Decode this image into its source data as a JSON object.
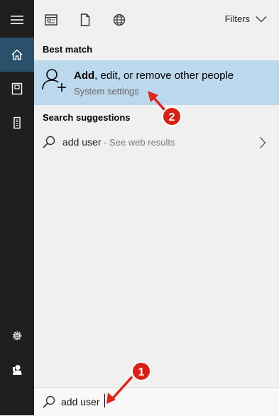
{
  "sidebar": {
    "items": [
      {
        "icon": "hamburger-menu-icon",
        "active": false
      },
      {
        "icon": "home-icon",
        "active": true
      },
      {
        "icon": "notebook-icon",
        "active": false
      },
      {
        "icon": "tower-device-icon",
        "active": false
      },
      {
        "icon": "settings-gear-icon",
        "active": false
      },
      {
        "icon": "user-icon",
        "active": false
      }
    ]
  },
  "topbar": {
    "scope_icons": [
      "apps-scope-icon",
      "documents-scope-icon",
      "web-scope-icon"
    ],
    "filters_label": "Filters"
  },
  "best_match": {
    "section_title": "Best match",
    "title_bold": "Add",
    "title_rest": ", edit, or remove other people",
    "subtitle": "System settings"
  },
  "suggestions": {
    "section_title": "Search suggestions",
    "items": [
      {
        "query": "add user",
        "separator": " - ",
        "hint": "See web results"
      }
    ]
  },
  "search": {
    "value": "add user",
    "placeholder": ""
  },
  "annotations": {
    "badge_1": "1",
    "badge_2": "2",
    "arrow_color": "#e0251b",
    "badge_color": "#d82114"
  },
  "colors": {
    "sidebar_bg": "#1f1f1f",
    "sidebar_active": "#2b506b",
    "highlight": "#bcd8ec"
  }
}
